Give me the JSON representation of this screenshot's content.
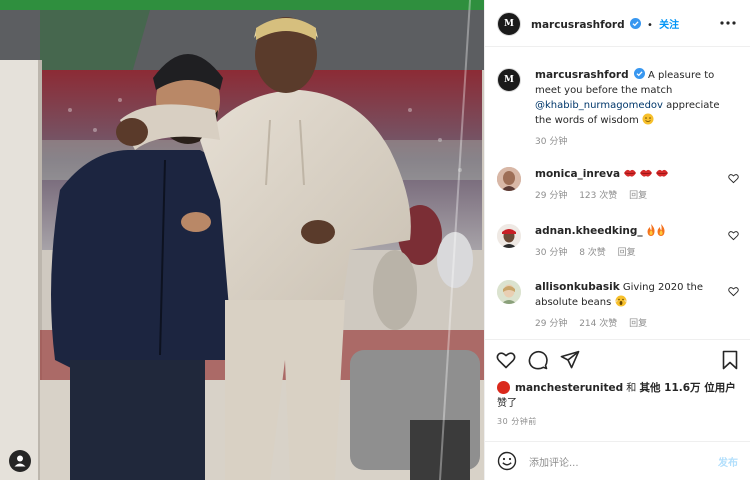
{
  "post": {
    "author": "marcusrashford",
    "follow_label": "关注",
    "avatar_initials": "M",
    "caption_text_1": "A pleasure to meet you before the match",
    "caption_mention": "@khabib_nurmagomedov",
    "caption_text_2": "appreciate the words of wisdom",
    "caption_time": "30 分钟"
  },
  "comments": [
    {
      "username": "monica_inreva",
      "text": "",
      "time": "29 分钟",
      "likes": "123 次赞",
      "reply": "回复"
    },
    {
      "username": "adnan.kheedking_",
      "text": "",
      "time": "30 分钟",
      "likes": "8 次赞",
      "reply": "回复"
    },
    {
      "username": "allisonkubasik",
      "text": "Giving 2020 the absolute beans",
      "time": "29 分钟",
      "likes": "214 次赞",
      "reply": "回复"
    }
  ],
  "likes_summary": {
    "user": "manchesterunited",
    "text_1": "和",
    "others_bold": "其他 11.6万 位用户",
    "text_2": "赞了"
  },
  "time_ago": "30 分钟前",
  "composer": {
    "placeholder": "添加评论...",
    "post_label": "发布"
  },
  "icons": {
    "header_more": "more-horizontal-icon",
    "like": "heart-icon",
    "comment": "comment-icon",
    "share": "paper-plane-icon",
    "save": "bookmark-icon",
    "emoji": "smile-icon",
    "tag": "user-tag-icon"
  },
  "colors": {
    "verified": "#3897f0",
    "follow": "#0095f6",
    "link": "#00376b",
    "meta": "#8e8e8e",
    "post_disabled": "#b2dffc",
    "brand_red": "#da291c"
  }
}
